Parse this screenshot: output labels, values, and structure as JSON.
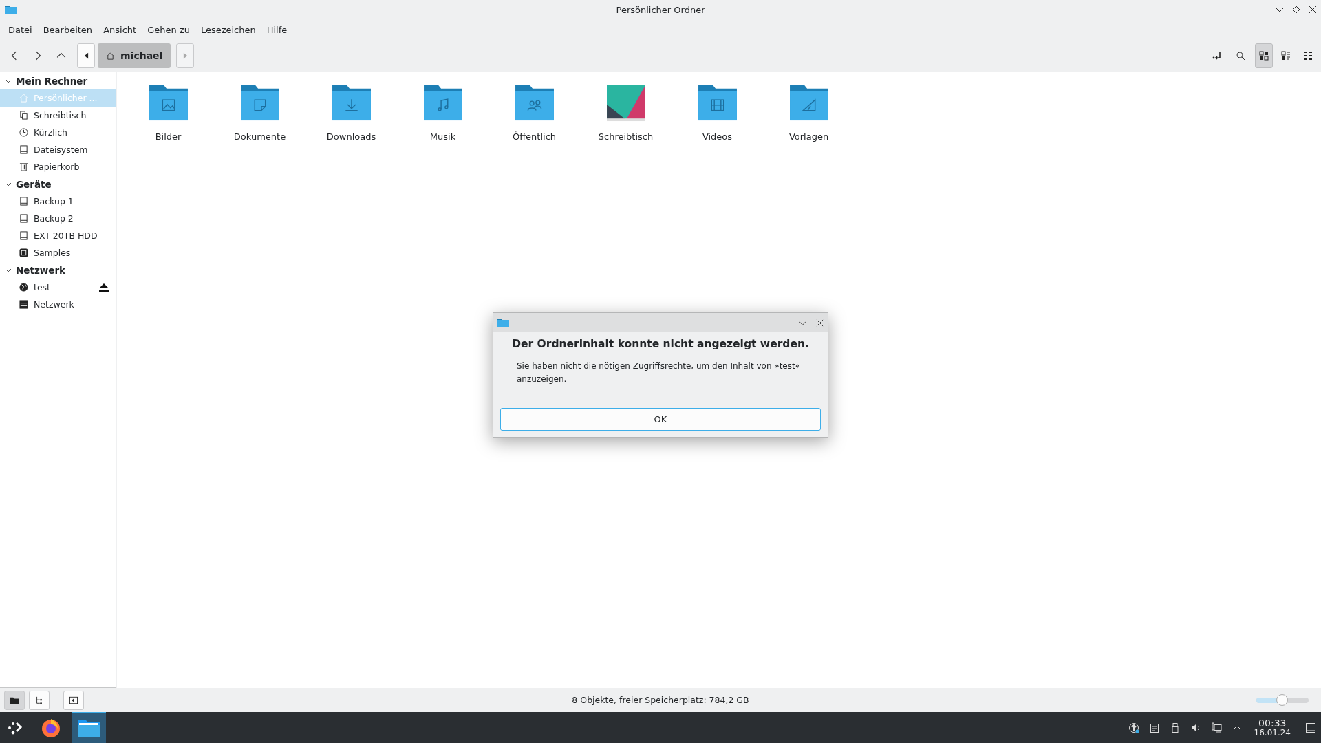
{
  "window": {
    "title": "Persönlicher Ordner"
  },
  "menu": [
    "Datei",
    "Bearbeiten",
    "Ansicht",
    "Gehen zu",
    "Lesezeichen",
    "Hilfe"
  ],
  "breadcrumb": {
    "label": "michael"
  },
  "view_modes": [
    {
      "kind": "icons",
      "selected": true
    },
    {
      "kind": "compact",
      "selected": false
    },
    {
      "kind": "details",
      "selected": false
    }
  ],
  "sidebar": {
    "groups": [
      {
        "label": "Mein Rechner",
        "expanded": true,
        "items": [
          {
            "label": "Persönlicher ...",
            "kind": "home",
            "selected": true,
            "eject": false
          },
          {
            "label": "Schreibtisch",
            "kind": "desktop",
            "selected": false,
            "eject": false
          },
          {
            "label": "Kürzlich",
            "kind": "recent",
            "selected": false,
            "eject": false
          },
          {
            "label": "Dateisystem",
            "kind": "drive",
            "selected": false,
            "eject": false
          },
          {
            "label": "Papierkorb",
            "kind": "trash",
            "selected": false,
            "eject": false
          }
        ]
      },
      {
        "label": "Geräte",
        "expanded": true,
        "items": [
          {
            "label": "Backup 1",
            "kind": "drive",
            "selected": false,
            "eject": false
          },
          {
            "label": "Backup 2",
            "kind": "drive",
            "selected": false,
            "eject": false
          },
          {
            "label": "EXT 20TB HDD",
            "kind": "drive",
            "selected": false,
            "eject": false
          },
          {
            "label": "Samples",
            "kind": "card",
            "selected": false,
            "eject": false
          }
        ]
      },
      {
        "label": "Netzwerk",
        "expanded": true,
        "items": [
          {
            "label": "test",
            "kind": "globe",
            "selected": false,
            "eject": true
          },
          {
            "label": "Netzwerk",
            "kind": "server",
            "selected": false,
            "eject": false
          }
        ]
      }
    ]
  },
  "folders": [
    {
      "label": "Bilder",
      "kind": "pictures"
    },
    {
      "label": "Dokumente",
      "kind": "documents"
    },
    {
      "label": "Downloads",
      "kind": "downloads"
    },
    {
      "label": "Musik",
      "kind": "music"
    },
    {
      "label": "Öffentlich",
      "kind": "public"
    },
    {
      "label": "Schreibtisch",
      "kind": "desktop"
    },
    {
      "label": "Videos",
      "kind": "videos"
    },
    {
      "label": "Vorlagen",
      "kind": "templates"
    }
  ],
  "dialog": {
    "heading": "Der Ordnerinhalt konnte nicht angezeigt werden.",
    "message": "Sie haben nicht die nötigen Zugriffsrechte, um den Inhalt von »test« anzuzeigen.",
    "button": "OK"
  },
  "bottom_buttons": [
    {
      "kind": "places",
      "selected": true
    },
    {
      "kind": "tree",
      "selected": false
    },
    {
      "kind": "panel",
      "selected": false
    }
  ],
  "status_bar": {
    "text": "8 Objekte, freier Speicherplatz: 784,2 GB",
    "zoom": {
      "level": 0.5
    }
  },
  "taskbar": {
    "apps": [
      {
        "kind": "browser",
        "selected": false
      },
      {
        "kind": "files",
        "selected": true
      }
    ],
    "time": "00:33",
    "date": "16.01.24"
  }
}
